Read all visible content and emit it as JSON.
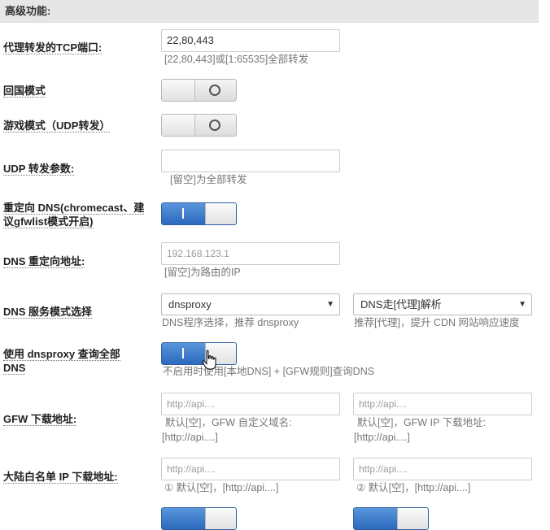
{
  "section": {
    "title": "高级功能:"
  },
  "rows": {
    "tcp_ports": {
      "label": "代理转发的TCP端口:",
      "value": "22,80,443",
      "hint": "[22,80,443]或[1:65535]全部转发"
    },
    "china_mode": {
      "label": "回国模式",
      "state": "off"
    },
    "game_mode": {
      "label": "游戏模式（UDP转发）",
      "state": "off"
    },
    "udp_params": {
      "label": "UDP 转发参数:",
      "value": "",
      "hint": "[留空]为全部转发"
    },
    "dns_redirect": {
      "label_line1": "重定向 DNS(chromecast、建",
      "label_line2": "议gfwlist模式开启)",
      "state": "on"
    },
    "dns_redirect_addr": {
      "label": "DNS 重定向地址:",
      "placeholder": "192.168.123.1",
      "hint": "[留空]为路由的IP"
    },
    "dns_service_mode": {
      "label": "DNS 服务模式选择",
      "select1": "dnsproxy",
      "select1_hint": "DNS程序选择，推荐 dnsproxy",
      "select2": "DNS走[代理]解析",
      "select2_hint": "推荐[代理]，提升 CDN 网站响应速度"
    },
    "dnsproxy_all": {
      "label_line1": "使用 dnsproxy 查询全部",
      "label_line2": "DNS",
      "state": "on",
      "hint": "不启用时使用[本地DNS] + [GFW规则]查询DNS"
    },
    "gfw_download": {
      "label": "GFW 下载地址:",
      "placeholder1": "http://api....",
      "hint1_line1": "默认[空]，GFW 自定义域名:",
      "hint1_line2": "[http://api....]",
      "placeholder2": "http://api....",
      "hint2_line1": "默认[空]，GFW IP 下载地址:",
      "hint2_line2": "[http://api....]"
    },
    "cn_whitelist": {
      "label": "大陆白名单 IP 下载地址:",
      "placeholder1": "http://api....",
      "hint1": "① 默认[空]，[http://api....]",
      "placeholder2": "http://api....",
      "hint2": "② 默认[空]，[http://api....]"
    }
  },
  "icons": {
    "cursor": "hand-pointer-icon",
    "select_arrow": "dropdown-arrow-icon"
  },
  "colors": {
    "toggle_on": "#2a69bd",
    "header_bg": "#e6e6e6"
  }
}
